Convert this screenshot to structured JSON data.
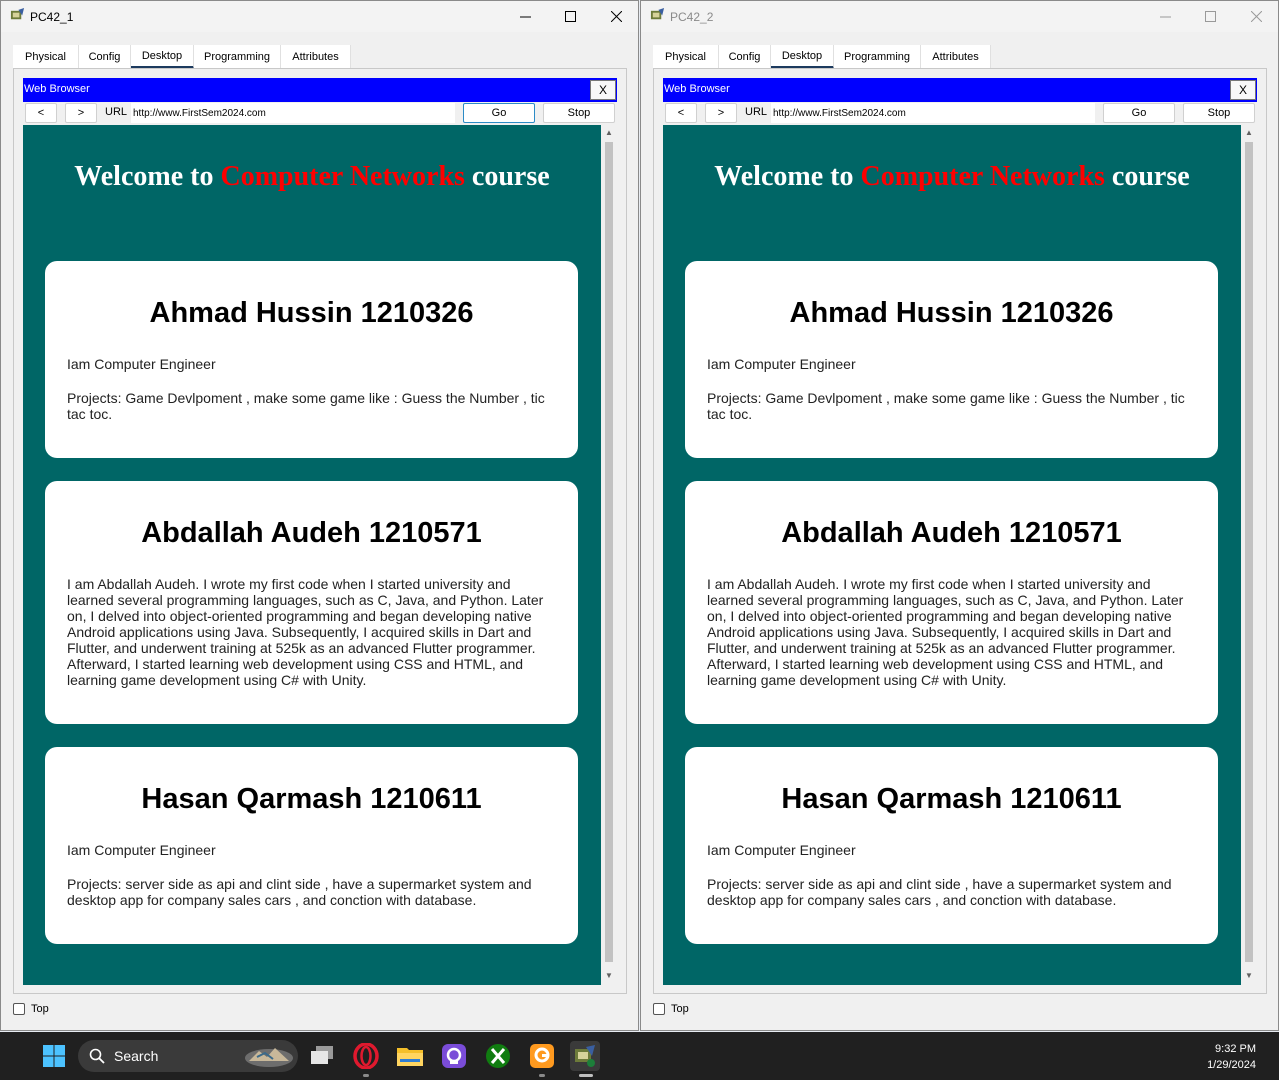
{
  "windows": [
    {
      "title": "PC42_1",
      "tabs": [
        "Physical",
        "Config",
        "Desktop",
        "Programming",
        "Attributes"
      ],
      "active_tab": "Desktop",
      "top_checkbox_label": "Top"
    },
    {
      "title": "PC42_2",
      "tabs": [
        "Physical",
        "Config",
        "Desktop",
        "Programming",
        "Attributes"
      ],
      "active_tab": "Desktop",
      "top_checkbox_label": "Top"
    }
  ],
  "browser": {
    "title": "Web Browser",
    "close_label": "X",
    "back_label": "<",
    "forward_label": ">",
    "url_label": "URL",
    "url_value": "http://www.FirstSem2024.com",
    "go_label": "Go",
    "stop_label": "Stop"
  },
  "page": {
    "heading_pre": "Welcome to ",
    "heading_highlight": "Computer Networks",
    "heading_post": " course",
    "highlight_color": "#ff0000",
    "background_color": "#006666",
    "cards": [
      {
        "name": "Ahmad Hussin 1210326",
        "lines": [
          "Iam Computer Engineer",
          "Projects: Game Devlpoment , make some game like : Guess the Number , tic tac toc."
        ]
      },
      {
        "name": "Abdallah Audeh 1210571",
        "lines": [
          "I am Abdallah Audeh. I wrote my first code when I started university and learned several programming languages, such as C, Java, and Python. Later on, I delved into object-oriented programming and began developing native Android applications using Java. Subsequently, I acquired skills in Dart and Flutter, and underwent training at 525k as an advanced Flutter programmer. Afterward, I started learning web development using CSS and HTML, and learning game development using C# with Unity."
        ]
      },
      {
        "name": "Hasan Qarmash 1210611",
        "lines": [
          "Iam Computer Engineer",
          "Projects: server side as api and clint side , have a supermarket system and desktop app for company sales cars , and conction with database."
        ]
      }
    ]
  },
  "taskbar": {
    "search_label": "Search",
    "time": "9:32 PM",
    "date": "1/29/2024",
    "icons": [
      "windows-start-icon",
      "search-icon",
      "task-view-icon",
      "opera-icon",
      "file-explorer-icon",
      "app-icon",
      "xbox-icon",
      "app-orange-icon",
      "packet-tracer-icon"
    ]
  }
}
